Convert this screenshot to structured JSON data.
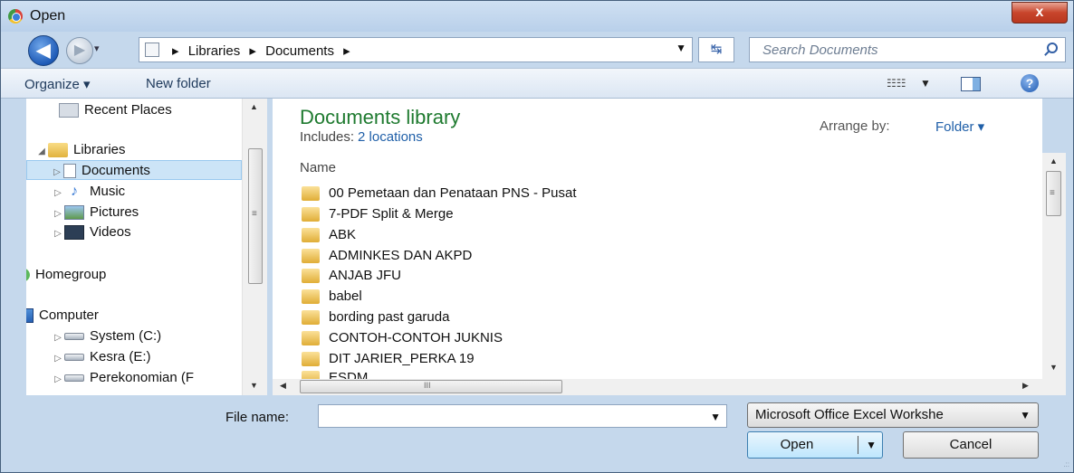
{
  "window": {
    "title": "Open",
    "close_label": "x"
  },
  "nav": {
    "back_glyph": "◀",
    "forward_glyph": "▶",
    "history_glyph": "▾",
    "breadcrumb": [
      "Libraries",
      "Documents"
    ],
    "breadcrumb_sep": "▸",
    "address_drop": "▼",
    "refresh_glyph": "↹",
    "search_placeholder": "Search Documents"
  },
  "toolbar": {
    "organize_label": "Organize ▾",
    "new_folder_label": "New folder",
    "views_glyph": "☷☷",
    "views_drop": "▼",
    "help_glyph": "?"
  },
  "navpane": {
    "items": [
      {
        "label": "Recent Places",
        "icon": "recent-places-icon",
        "expander": ""
      },
      {
        "label": "Libraries",
        "icon": "libraries-icon",
        "expander": "◢"
      },
      {
        "label": "Documents",
        "icon": "documents-icon",
        "expander": "▷"
      },
      {
        "label": "Music",
        "icon": "music-icon",
        "expander": "▷"
      },
      {
        "label": "Pictures",
        "icon": "pictures-icon",
        "expander": "▷"
      },
      {
        "label": "Videos",
        "icon": "videos-icon",
        "expander": "▷"
      },
      {
        "label": "Homegroup",
        "icon": "homegroup-icon",
        "expander": "▷"
      },
      {
        "label": "Computer",
        "icon": "computer-icon",
        "expander": "◢"
      },
      {
        "label": "System (C:)",
        "icon": "drive-icon",
        "expander": "▷"
      },
      {
        "label": "Kesra (E:)",
        "icon": "drive-icon",
        "expander": "▷"
      },
      {
        "label": "Perekonomian (F",
        "icon": "drive-icon",
        "expander": "▷"
      }
    ],
    "scroll_up": "▲",
    "scroll_down": "▼",
    "scroll_grip": "≡"
  },
  "content": {
    "library_title": "Documents library",
    "includes_label": "Includes:",
    "includes_link": "2 locations",
    "arrange_label": "Arrange by:",
    "arrange_value": "Folder ▾",
    "column_name": "Name",
    "files": [
      "00 Pemetaan dan Penataan PNS - Pusat",
      "7-PDF Split & Merge",
      "ABK",
      "ADMINKES DAN AKPD",
      "ANJAB JFU",
      "babel",
      "bording past garuda",
      "CONTOH-CONTOH JUKNIS",
      "DIT JARIER_PERKA 19",
      "ESDM"
    ],
    "vscroll_grip": "≡",
    "hscroll_grip": "III",
    "scroll_left": "◀",
    "scroll_right": "▶",
    "scroll_up": "▲",
    "scroll_down": "▼"
  },
  "bottom": {
    "file_name_label": "File name:",
    "file_name_value": "",
    "file_name_drop": "▼",
    "file_type_value": "Microsoft Office Excel Workshe",
    "file_type_drop": "▼",
    "open_label": "Open",
    "open_drop": "▼",
    "cancel_label": "Cancel",
    "grip": ".::"
  }
}
